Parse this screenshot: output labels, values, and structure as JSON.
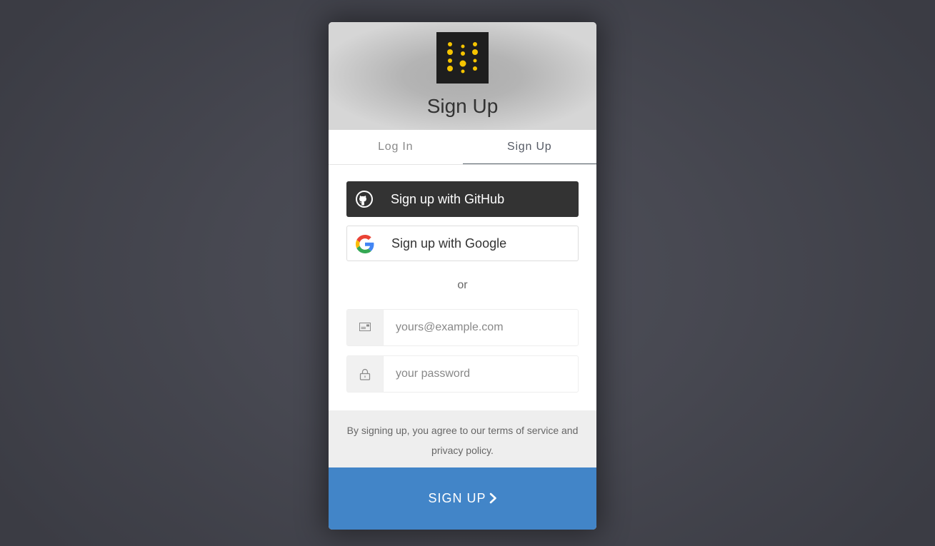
{
  "header": {
    "title": "Sign Up",
    "logo": "yellow-dots-logo",
    "logo_color": "#f5c400"
  },
  "tabs": [
    {
      "label": "Log In",
      "active": false
    },
    {
      "label": "Sign Up",
      "active": true
    }
  ],
  "social": {
    "github_label": "Sign up with GitHub",
    "github_icon": "github-icon",
    "google_label": "Sign up with Google",
    "google_icon": "google-icon"
  },
  "separator": "or",
  "form": {
    "email_placeholder": "yours@example.com",
    "email_value": "",
    "email_icon": "envelope-icon",
    "password_placeholder": "your password",
    "password_value": "",
    "password_icon": "lock-icon"
  },
  "terms_text": "By signing up, you agree to our terms of service and privacy policy.",
  "submit": {
    "label": "SIGN UP",
    "icon": "chevron-right-icon"
  },
  "colors": {
    "submit_bg": "#4285c8",
    "github_bg": "#333333",
    "background": "#474851"
  }
}
